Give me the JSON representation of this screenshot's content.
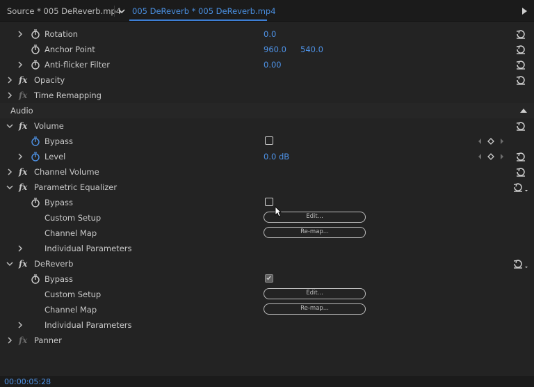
{
  "tabs": {
    "source_label": "Source * 005 DeReverb.mp4",
    "active_label": "005 DeReverb * 005 DeReverb.mp4"
  },
  "rows": {
    "rotation": {
      "label": "Rotation",
      "value": "0.0"
    },
    "anchor_point": {
      "label": "Anchor Point",
      "value_x": "960.0",
      "value_y": "540.0"
    },
    "anti_flicker": {
      "label": "Anti-flicker Filter",
      "value": "0.00"
    },
    "opacity": {
      "label": "Opacity"
    },
    "time_remapping": {
      "label": "Time Remapping"
    },
    "audio_header": {
      "label": "Audio"
    },
    "volume": {
      "label": "Volume"
    },
    "volume_bypass": {
      "label": "Bypass"
    },
    "volume_level": {
      "label": "Level",
      "value": "0.0 dB"
    },
    "channel_volume": {
      "label": "Channel Volume"
    },
    "param_eq": {
      "label": "Parametric Equalizer"
    },
    "param_eq_bypass": {
      "label": "Bypass"
    },
    "param_eq_custom": {
      "label": "Custom Setup",
      "button": "Edit..."
    },
    "param_eq_channel_map": {
      "label": "Channel Map",
      "button": "Re-map..."
    },
    "param_eq_individual": {
      "label": "Individual Parameters"
    },
    "dereverb": {
      "label": "DeReverb"
    },
    "dereverb_bypass": {
      "label": "Bypass"
    },
    "dereverb_custom": {
      "label": "Custom Setup",
      "button": "Edit..."
    },
    "dereverb_channel_map": {
      "label": "Channel Map",
      "button": "Re-map..."
    },
    "dereverb_individual": {
      "label": "Individual Parameters"
    },
    "panner": {
      "label": "Panner"
    }
  },
  "timecode": "00:00:05:28",
  "colors": {
    "accent_blue": "#4e93e8",
    "panel_bg": "#232323"
  },
  "icons": [
    "stopwatch-icon",
    "reset-icon",
    "fx-icon",
    "chevron-right-icon",
    "chevron-down-icon",
    "keyframe-nav-icon",
    "checkbox-icon"
  ]
}
